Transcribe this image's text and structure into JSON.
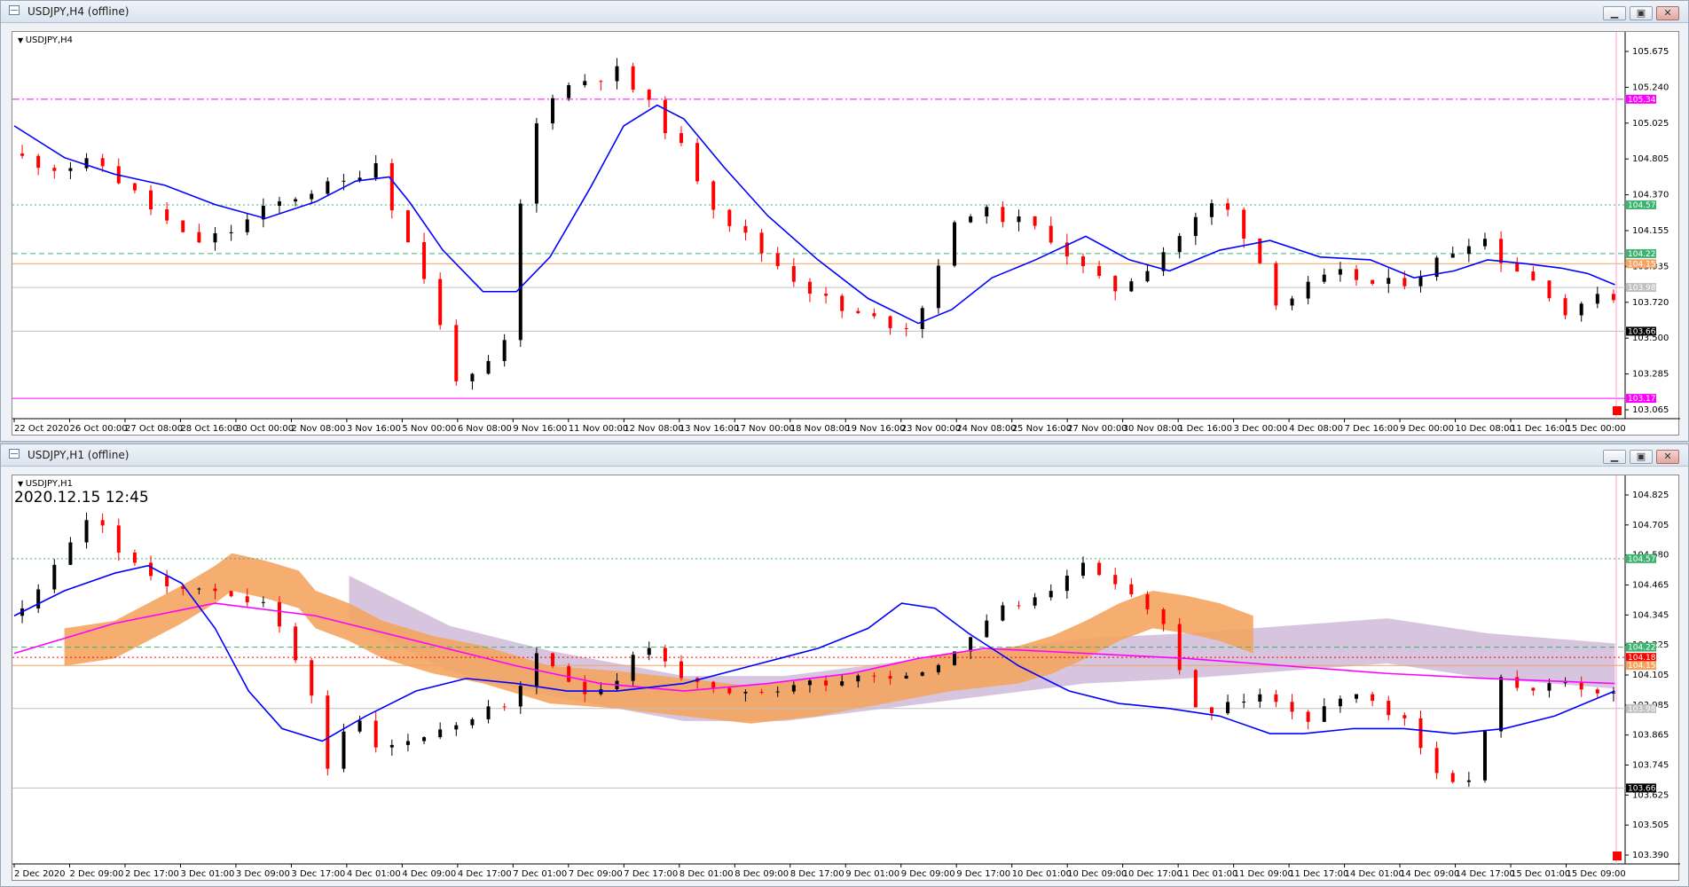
{
  "windows": [
    {
      "id": "h4",
      "title": "USDJPY,H4 (offline)",
      "symbol_label": "USDJPY,H4",
      "time_text": "",
      "chart_data": {
        "type": "candlestick",
        "symbol": "USDJPY",
        "timeframe": "H4",
        "y_ticks": [
          "105.675",
          "105.240",
          "105.025",
          "104.805",
          "104.370",
          "104.155",
          "103.935",
          "103.720",
          "103.500",
          "103.285",
          "103.065"
        ],
        "x_ticks": [
          "22 Oct 2020",
          "26 Oct 00:00",
          "27 Oct 08:00",
          "28 Oct 16:00",
          "30 Oct 00:00",
          "2 Nov 08:00",
          "3 Nov 16:00",
          "5 Nov 00:00",
          "6 Nov 08:00",
          "9 Nov 16:00",
          "11 Nov 00:00",
          "12 Nov 08:00",
          "13 Nov 16:00",
          "17 Nov 00:00",
          "18 Nov 08:00",
          "19 Nov 16:00",
          "23 Nov 00:00",
          "24 Nov 08:00",
          "25 Nov 16:00",
          "27 Nov 00:00",
          "30 Nov 08:00",
          "1 Dec 16:00",
          "3 Dec 00:00",
          "4 Dec 08:00",
          "7 Dec 16:00",
          "9 Dec 00:00",
          "10 Dec 08:00",
          "11 Dec 16:00",
          "15 Dec 00:00"
        ],
        "ylim": [
          103.03,
          105.83
        ],
        "price_levels": [
          {
            "value": 105.343,
            "label": "105.343",
            "color": "#ff00ff",
            "style": "dashdot",
            "badge": "#ff00ff"
          },
          {
            "value": 104.578,
            "label": "104.578",
            "color": "#3cb371",
            "style": "dotted",
            "badge": "#3cb371"
          },
          {
            "value": 104.225,
            "label": "104.225",
            "color": "#3cb371",
            "style": "dashed",
            "badge": "#3cb371"
          },
          {
            "value": 104.152,
            "label": "104.152",
            "color": "#f4a460",
            "style": "solid",
            "badge": "#f4a460"
          },
          {
            "value": 103.98,
            "label": "103.980",
            "color": "#c0c0c0",
            "style": "solid",
            "badge": "#c0c0c0"
          },
          {
            "value": 103.663,
            "label": "103.663",
            "color": "#c0c0c0",
            "style": "solid",
            "badge": "#000000"
          },
          {
            "value": 103.177,
            "label": "103.177",
            "color": "#ff00ff",
            "style": "solid",
            "badge": "#ff00ff"
          }
        ],
        "close_path": [
          [
            0,
            104.95
          ],
          [
            15,
            104.85
          ],
          [
            28,
            104.88
          ],
          [
            40,
            104.62
          ],
          [
            55,
            104.3
          ],
          [
            65,
            104.36
          ],
          [
            78,
            104.55
          ],
          [
            90,
            104.68
          ],
          [
            102,
            104.74
          ],
          [
            110,
            104.92
          ],
          [
            118,
            104.4
          ],
          [
            127,
            103.95
          ],
          [
            133,
            103.35
          ],
          [
            140,
            103.3
          ],
          [
            150,
            103.6
          ],
          [
            155,
            104.95
          ],
          [
            162,
            105.38
          ],
          [
            172,
            105.48
          ],
          [
            182,
            105.55
          ],
          [
            190,
            105.35
          ],
          [
            200,
            105.05
          ],
          [
            212,
            104.55
          ],
          [
            225,
            104.25
          ],
          [
            238,
            104.0
          ],
          [
            250,
            103.8
          ],
          [
            262,
            103.73
          ],
          [
            272,
            103.7
          ],
          [
            276,
            104.05
          ],
          [
            286,
            104.55
          ],
          [
            300,
            104.48
          ],
          [
            312,
            104.35
          ],
          [
            322,
            104.1
          ],
          [
            330,
            103.95
          ],
          [
            340,
            104.12
          ],
          [
            350,
            104.35
          ],
          [
            362,
            104.62
          ],
          [
            372,
            104.3
          ],
          [
            380,
            103.85
          ],
          [
            390,
            104.0
          ],
          [
            400,
            104.08
          ],
          [
            410,
            103.98
          ],
          [
            420,
            104.05
          ],
          [
            432,
            104.25
          ],
          [
            440,
            104.38
          ],
          [
            446,
            104.2
          ],
          [
            455,
            104.05
          ],
          [
            462,
            103.93
          ],
          [
            468,
            103.7
          ],
          [
            474,
            104.0
          ],
          [
            478,
            103.9
          ]
        ],
        "ma_path": [
          [
            0,
            105.15
          ],
          [
            15,
            104.92
          ],
          [
            30,
            104.8
          ],
          [
            45,
            104.72
          ],
          [
            60,
            104.58
          ],
          [
            75,
            104.48
          ],
          [
            90,
            104.6
          ],
          [
            102,
            104.75
          ],
          [
            112,
            104.78
          ],
          [
            118,
            104.6
          ],
          [
            128,
            104.25
          ],
          [
            140,
            103.95
          ],
          [
            150,
            103.95
          ],
          [
            160,
            104.2
          ],
          [
            172,
            104.7
          ],
          [
            182,
            105.15
          ],
          [
            192,
            105.3
          ],
          [
            200,
            105.2
          ],
          [
            212,
            104.85
          ],
          [
            225,
            104.5
          ],
          [
            240,
            104.18
          ],
          [
            255,
            103.9
          ],
          [
            270,
            103.72
          ],
          [
            280,
            103.82
          ],
          [
            292,
            104.05
          ],
          [
            305,
            104.18
          ],
          [
            320,
            104.35
          ],
          [
            333,
            104.18
          ],
          [
            345,
            104.1
          ],
          [
            360,
            104.25
          ],
          [
            375,
            104.32
          ],
          [
            390,
            104.2
          ],
          [
            405,
            104.18
          ],
          [
            418,
            104.05
          ],
          [
            430,
            104.1
          ],
          [
            440,
            104.18
          ],
          [
            452,
            104.15
          ],
          [
            462,
            104.12
          ],
          [
            470,
            104.08
          ],
          [
            478,
            104.0
          ]
        ]
      }
    },
    {
      "id": "h1",
      "title": "USDJPY,H1 (offline)",
      "symbol_label": "USDJPY,H1",
      "time_text": "2020.12.15 12:45",
      "chart_data": {
        "type": "candlestick",
        "symbol": "USDJPY",
        "timeframe": "H1",
        "y_ticks": [
          "104.825",
          "104.705",
          "104.580",
          "104.465",
          "104.345",
          "104.225",
          "104.105",
          "103.985",
          "103.865",
          "103.745",
          "103.625",
          "103.505",
          "103.390"
        ],
        "x_ticks": [
          "2 Dec 2020",
          "2 Dec 09:00",
          "2 Dec 17:00",
          "3 Dec 01:00",
          "3 Dec 09:00",
          "3 Dec 17:00",
          "4 Dec 01:00",
          "4 Dec 09:00",
          "4 Dec 17:00",
          "7 Dec 01:00",
          "7 Dec 09:00",
          "7 Dec 17:00",
          "8 Dec 01:00",
          "8 Dec 09:00",
          "8 Dec 17:00",
          "9 Dec 01:00",
          "9 Dec 09:00",
          "9 Dec 17:00",
          "10 Dec 01:00",
          "10 Dec 09:00",
          "10 Dec 17:00",
          "11 Dec 01:00",
          "11 Dec 09:00",
          "11 Dec 17:00",
          "14 Dec 01:00",
          "14 Dec 09:00",
          "14 Dec 17:00",
          "15 Dec 01:00",
          "15 Dec 09:00"
        ],
        "ylim": [
          103.36,
          104.91
        ],
        "price_levels": [
          {
            "value": 104.578,
            "label": "104.578",
            "color": "#3cb371",
            "style": "dotted",
            "badge": "#3cb371"
          },
          {
            "value": 104.225,
            "label": "104.225",
            "color": "#3cb371",
            "style": "dashed",
            "badge": "#3cb371"
          },
          {
            "value": 104.184,
            "label": "104.184",
            "color": "#ff0000",
            "style": "dotted",
            "badge": "#ff0000"
          },
          {
            "value": 104.152,
            "label": "104.152",
            "color": "#f4a460",
            "style": "solid",
            "badge": "#f4a460"
          },
          {
            "value": 103.98,
            "label": "103.980",
            "color": "#c0c0c0",
            "style": "solid",
            "badge": "#c0c0c0"
          },
          {
            "value": 103.663,
            "label": "103.663",
            "color": "#c0c0c0",
            "style": "solid",
            "badge": "#000000"
          }
        ],
        "close_path": [
          [
            0,
            104.35
          ],
          [
            10,
            104.45
          ],
          [
            20,
            104.68
          ],
          [
            28,
            104.75
          ],
          [
            36,
            104.55
          ],
          [
            46,
            104.5
          ],
          [
            56,
            104.45
          ],
          [
            66,
            104.45
          ],
          [
            76,
            104.4
          ],
          [
            84,
            104.25
          ],
          [
            90,
            104.1
          ],
          [
            96,
            103.75
          ],
          [
            104,
            103.95
          ],
          [
            112,
            103.82
          ],
          [
            120,
            103.85
          ],
          [
            130,
            103.9
          ],
          [
            140,
            103.95
          ],
          [
            150,
            104.0
          ],
          [
            158,
            104.18
          ],
          [
            166,
            104.1
          ],
          [
            174,
            104.05
          ],
          [
            182,
            104.1
          ],
          [
            190,
            104.25
          ],
          [
            198,
            104.15
          ],
          [
            208,
            104.05
          ],
          [
            218,
            104.02
          ],
          [
            228,
            104.05
          ],
          [
            238,
            104.08
          ],
          [
            248,
            104.1
          ],
          [
            258,
            104.12
          ],
          [
            268,
            104.12
          ],
          [
            278,
            104.15
          ],
          [
            288,
            104.28
          ],
          [
            298,
            104.38
          ],
          [
            308,
            104.42
          ],
          [
            318,
            104.55
          ],
          [
            328,
            104.52
          ],
          [
            338,
            104.4
          ],
          [
            346,
            104.3
          ],
          [
            356,
            103.95
          ],
          [
            366,
            104.0
          ],
          [
            376,
            104.05
          ],
          [
            386,
            103.92
          ],
          [
            396,
            104.0
          ],
          [
            406,
            104.02
          ],
          [
            416,
            103.95
          ],
          [
            426,
            103.75
          ],
          [
            436,
            103.65
          ],
          [
            446,
            104.1
          ],
          [
            456,
            104.05
          ],
          [
            466,
            104.08
          ],
          [
            476,
            104.05
          ],
          [
            486,
            103.98
          ]
        ],
        "ma_blue": [
          [
            0,
            104.35
          ],
          [
            15,
            104.45
          ],
          [
            30,
            104.52
          ],
          [
            40,
            104.55
          ],
          [
            50,
            104.48
          ],
          [
            60,
            104.3
          ],
          [
            70,
            104.05
          ],
          [
            80,
            103.9
          ],
          [
            92,
            103.85
          ],
          [
            105,
            103.95
          ],
          [
            120,
            104.05
          ],
          [
            135,
            104.1
          ],
          [
            150,
            104.08
          ],
          [
            165,
            104.05
          ],
          [
            180,
            104.05
          ],
          [
            200,
            104.08
          ],
          [
            220,
            104.15
          ],
          [
            240,
            104.22
          ],
          [
            255,
            104.3
          ],
          [
            265,
            104.4
          ],
          [
            275,
            104.38
          ],
          [
            285,
            104.28
          ],
          [
            300,
            104.15
          ],
          [
            315,
            104.05
          ],
          [
            330,
            104.0
          ],
          [
            345,
            103.98
          ],
          [
            360,
            103.95
          ],
          [
            375,
            103.88
          ],
          [
            385,
            103.88
          ],
          [
            400,
            103.9
          ],
          [
            415,
            103.9
          ],
          [
            430,
            103.88
          ],
          [
            445,
            103.9
          ],
          [
            460,
            103.95
          ],
          [
            478,
            104.05
          ]
        ],
        "ma_magenta": [
          [
            0,
            104.2
          ],
          [
            30,
            104.32
          ],
          [
            60,
            104.4
          ],
          [
            90,
            104.35
          ],
          [
            120,
            104.25
          ],
          [
            150,
            104.15
          ],
          [
            175,
            104.08
          ],
          [
            200,
            104.05
          ],
          [
            225,
            104.08
          ],
          [
            250,
            104.12
          ],
          [
            270,
            104.18
          ],
          [
            290,
            104.22
          ],
          [
            320,
            104.2
          ],
          [
            350,
            104.18
          ],
          [
            380,
            104.15
          ],
          [
            410,
            104.12
          ],
          [
            440,
            104.1
          ],
          [
            478,
            104.08
          ]
        ],
        "cloud_orange": [
          [
            15,
            104.25
          ],
          [
            30,
            104.28
          ],
          [
            40,
            104.35
          ],
          [
            50,
            104.42
          ],
          [
            60,
            104.5
          ],
          [
            65,
            104.55
          ],
          [
            75,
            104.52
          ],
          [
            80,
            104.5
          ],
          [
            85,
            104.48
          ],
          [
            90,
            104.4
          ],
          [
            100,
            104.35
          ],
          [
            110,
            104.28
          ],
          [
            125,
            104.22
          ],
          [
            140,
            104.18
          ],
          [
            160,
            104.1
          ],
          [
            180,
            104.08
          ],
          [
            200,
            104.05
          ],
          [
            220,
            104.02
          ],
          [
            240,
            104.05
          ],
          [
            260,
            104.1
          ],
          [
            280,
            104.15
          ],
          [
            300,
            104.18
          ],
          [
            310,
            104.22
          ],
          [
            320,
            104.28
          ],
          [
            330,
            104.35
          ],
          [
            340,
            104.4
          ],
          [
            350,
            104.38
          ],
          [
            360,
            104.35
          ],
          [
            370,
            104.3
          ]
        ],
        "cloud_purple_band": [
          [
            100,
            104.45
          ],
          [
            130,
            104.25
          ],
          [
            160,
            104.15
          ],
          [
            200,
            104.05
          ],
          [
            230,
            104.05
          ],
          [
            260,
            104.1
          ],
          [
            290,
            104.15
          ],
          [
            320,
            104.2
          ],
          [
            350,
            104.22
          ],
          [
            380,
            104.25
          ],
          [
            410,
            104.28
          ],
          [
            440,
            104.22
          ],
          [
            478,
            104.18
          ]
        ]
      }
    }
  ]
}
